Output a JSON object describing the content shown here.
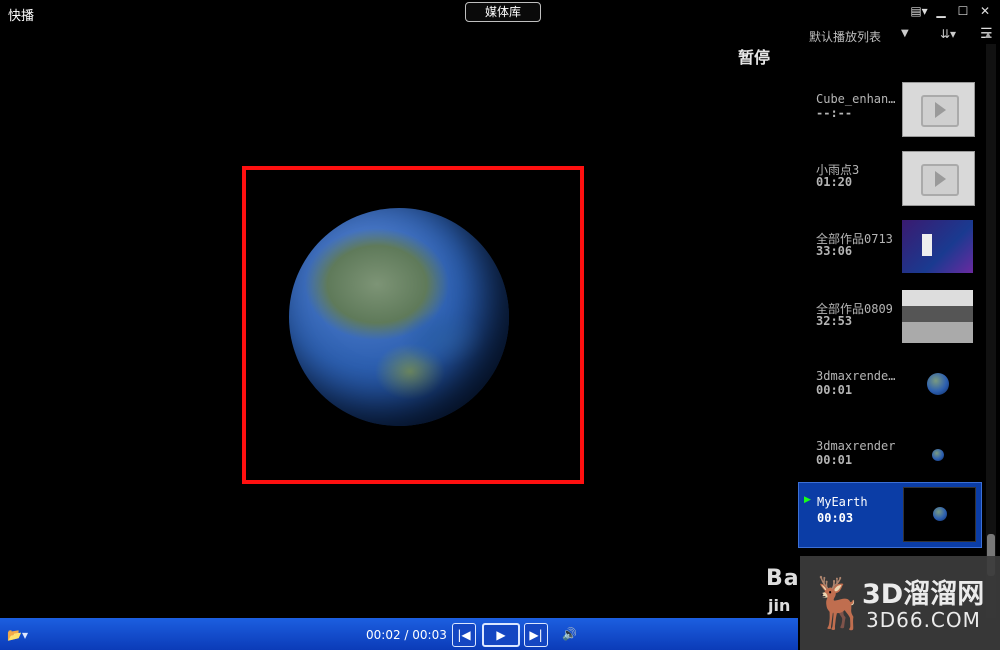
{
  "app": {
    "title": "快播"
  },
  "toolbar": {
    "media_library_label": "媒体库"
  },
  "window_controls": [
    {
      "name": "skin-icon",
      "glyph": "▤▾"
    },
    {
      "name": "minimize-icon",
      "glyph": "▁"
    },
    {
      "name": "maximize-icon",
      "glyph": "☐"
    },
    {
      "name": "close-icon",
      "glyph": "✕"
    }
  ],
  "video": {
    "status_text": "暂停",
    "highlight_color": "#ff1010"
  },
  "playlist": {
    "title": "默认播放列表",
    "dropdown_glyph": "▼",
    "sort_glyph": "⇊▾",
    "menu_glyph": "☰",
    "items": [
      {
        "name": "Cube_enhan…",
        "duration": "--:--",
        "thumb": "blank",
        "active": false
      },
      {
        "name": "小雨点3",
        "duration": "01:20",
        "thumb": "blank",
        "active": false
      },
      {
        "name": "全部作品0713",
        "duration": "33:06",
        "thumb": "stage",
        "active": false
      },
      {
        "name": "全部作品0809",
        "duration": "32:53",
        "thumb": "meeting",
        "active": false
      },
      {
        "name": "3dmaxrende…",
        "duration": "00:01",
        "thumb": "earth",
        "active": false
      },
      {
        "name": "3dmaxrender",
        "duration": "00:01",
        "thumb": "earth-tiny",
        "active": false
      },
      {
        "name": "MyEarth",
        "duration": "00:03",
        "thumb": "active",
        "active": true
      }
    ],
    "play_indicator_glyph": "▶"
  },
  "controls": {
    "open_glyph": "📂▾",
    "time": "00:02 / 00:03",
    "prev_glyph": "|◀",
    "play_glyph": "▶",
    "next_glyph": "▶|",
    "volume_glyph": "🔊"
  },
  "watermark": {
    "baidu_text": "Ba",
    "jing_text": "jin",
    "brand_text": "3D溜溜网",
    "site_text": "3D66.COM",
    "deer_glyph": "🦌"
  }
}
